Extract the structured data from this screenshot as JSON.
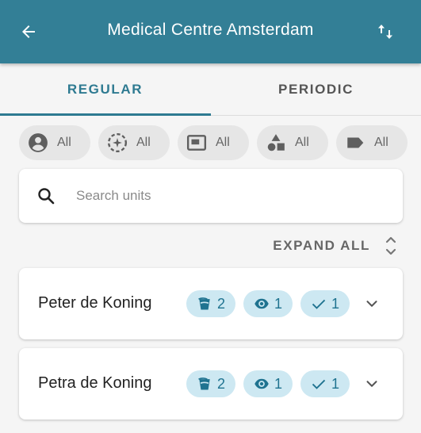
{
  "header": {
    "title": "Medical Centre Amsterdam",
    "back_icon": "arrow-left-icon",
    "sort_icon": "sort-arrows-icon",
    "background": "#337f96"
  },
  "tabs": [
    {
      "label": "REGULAR",
      "active": true
    },
    {
      "label": "PERIODIC",
      "active": false
    }
  ],
  "filters": [
    {
      "icon": "person-circle-icon",
      "label": "All"
    },
    {
      "icon": "dashed-target-icon",
      "label": "All"
    },
    {
      "icon": "display-icon",
      "label": "All"
    },
    {
      "icon": "shapes-icon",
      "label": "All"
    },
    {
      "icon": "tag-icon",
      "label": "All"
    }
  ],
  "search": {
    "placeholder": "Search units",
    "value": ""
  },
  "expand_all": {
    "label": "EXPAND ALL",
    "icon": "unfold-icon"
  },
  "units": [
    {
      "name": "Peter de Koning",
      "badges": [
        {
          "icon": "bucket-icon",
          "count": "2"
        },
        {
          "icon": "eye-icon",
          "count": "1"
        },
        {
          "icon": "check-icon",
          "count": "1"
        }
      ]
    },
    {
      "name": "Petra de Koning",
      "badges": [
        {
          "icon": "bucket-icon",
          "count": "2"
        },
        {
          "icon": "eye-icon",
          "count": "1"
        },
        {
          "icon": "check-icon",
          "count": "1"
        }
      ]
    }
  ],
  "colors": {
    "accent": "#2e7a91",
    "badge_bg": "#cde8f2",
    "badge_fg": "#1f7390"
  }
}
